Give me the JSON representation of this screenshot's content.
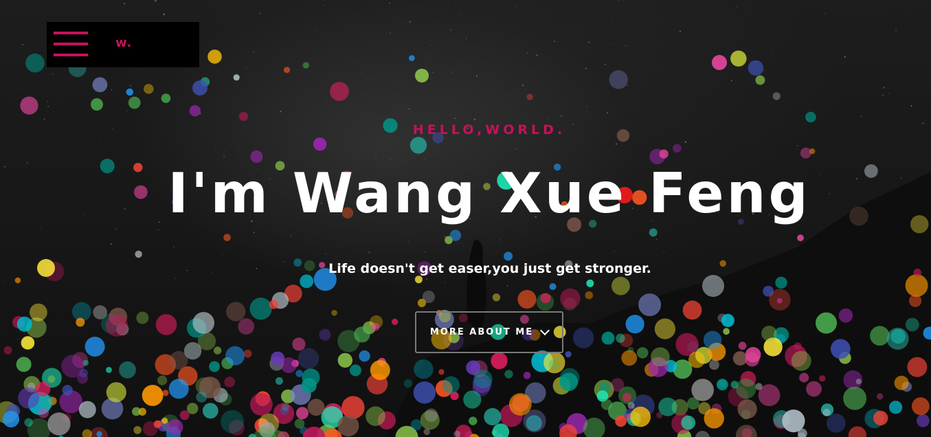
{
  "nav": {
    "brand": "w.",
    "menu_icon": "hamburger-menu-icon"
  },
  "hero": {
    "eyebrow": "HELLO,WORLD.",
    "headline": "I'm Wang Xue Feng",
    "tagline": "Life doesn't get easer,you just get stronger.",
    "cta_label": "MORE ABOUT ME",
    "cta_icon": "chevron-down-icon"
  },
  "colors": {
    "accent": "#c8115c",
    "background": "#141414",
    "text": "#ffffff",
    "nav_background": "#000000",
    "button_border": "#7a7a7a"
  }
}
